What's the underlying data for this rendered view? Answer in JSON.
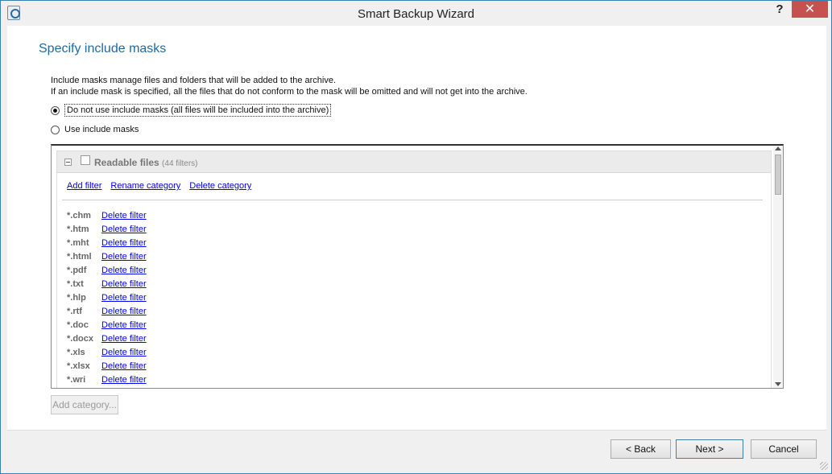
{
  "window": {
    "title": "Smart Backup Wizard",
    "help_label": "?",
    "close_label": "✕"
  },
  "page": {
    "title": "Specify include masks",
    "description_line1": "Include masks manage files and folders that will be added to the archive.",
    "description_line2": "If an include mask is specified, all the files that do not conform to the mask will be omitted and will not get into the archive."
  },
  "options": {
    "no_masks_label": "Do not use include masks (all files will be included into the archive)",
    "no_masks_selected": true,
    "use_masks_label": "Use include masks",
    "use_masks_selected": false
  },
  "category": {
    "name": "Readable files",
    "count_text": "(44 filters)",
    "checked": false,
    "add_filter_label": "Add filter",
    "rename_label": "Rename category",
    "delete_label": "Delete category"
  },
  "filters": [
    {
      "mask": "*.chm",
      "action": "Delete filter"
    },
    {
      "mask": "*.htm",
      "action": "Delete filter"
    },
    {
      "mask": "*.mht",
      "action": "Delete filter"
    },
    {
      "mask": "*.html",
      "action": "Delete filter"
    },
    {
      "mask": "*.pdf",
      "action": "Delete filter"
    },
    {
      "mask": "*.txt",
      "action": "Delete filter"
    },
    {
      "mask": "*.hlp",
      "action": "Delete filter"
    },
    {
      "mask": "*.rtf",
      "action": "Delete filter"
    },
    {
      "mask": "*.doc",
      "action": "Delete filter"
    },
    {
      "mask": "*.docx",
      "action": "Delete filter"
    },
    {
      "mask": "*.xls",
      "action": "Delete filter"
    },
    {
      "mask": "*.xlsx",
      "action": "Delete filter"
    },
    {
      "mask": "*.wri",
      "action": "Delete filter"
    }
  ],
  "buttons": {
    "add_category": "Add category...",
    "back": "< Back",
    "next": "Next >",
    "cancel": "Cancel"
  },
  "colors": {
    "title_accent": "#1e6aa5",
    "link": "#0000ee",
    "close_button": "#c75050"
  }
}
